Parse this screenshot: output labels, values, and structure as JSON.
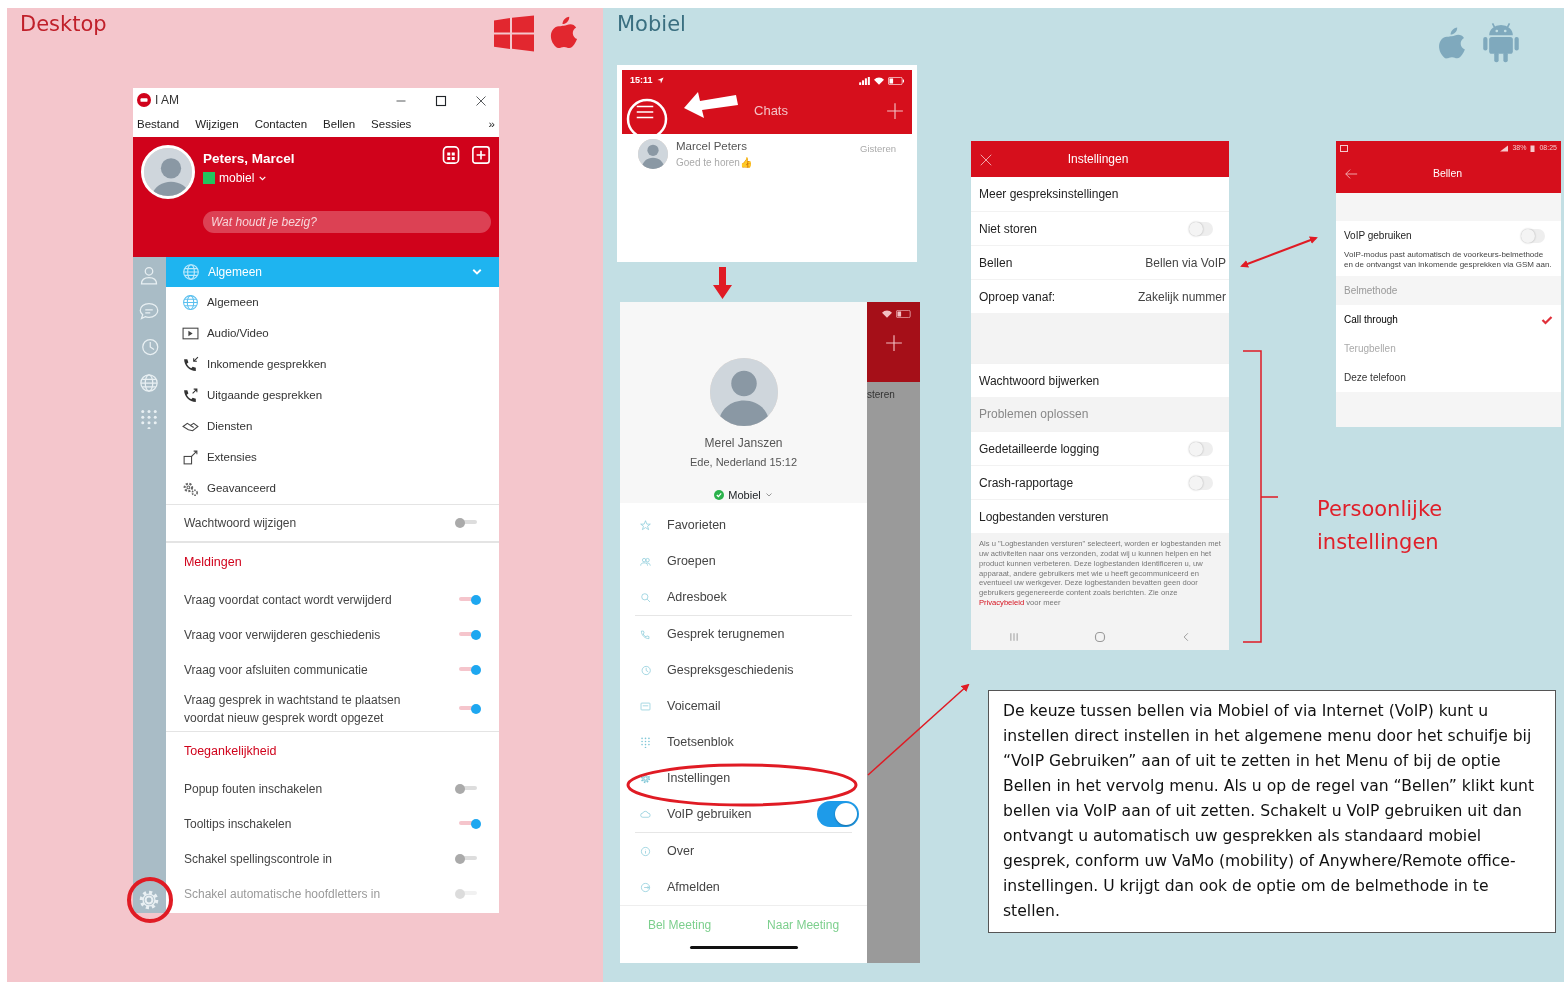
{
  "desktop_label": "Desktop",
  "mobile_label": "Mobiel",
  "desktop_app": {
    "title": "I AM",
    "menu": [
      "Bestand",
      "Wijzigen",
      "Contacten",
      "Bellen",
      "Sessies"
    ],
    "menu_overflow": "»",
    "profile": {
      "name": "Peters, Marcel",
      "status": "mobiel",
      "mood_placeholder": "Wat houdt je bezig?"
    },
    "category": {
      "label": "Algemeen",
      "expanded": true,
      "items": [
        "Algemeen",
        "Audio/Video",
        "Inkomende gesprekken",
        "Uitgaande gesprekken",
        "Diensten",
        "Extensies",
        "Geavanceerd"
      ]
    },
    "settings": [
      {
        "kind": "toggle",
        "label": "Wachtwoord wijzigen",
        "on": false,
        "faded": false
      },
      {
        "kind": "heading",
        "label": "Meldingen"
      },
      {
        "kind": "toggle",
        "label": "Vraag voordat contact wordt verwijderd",
        "on": true,
        "faded": false
      },
      {
        "kind": "toggle",
        "label": "Vraag voor verwijderen geschiedenis",
        "on": true,
        "faded": false
      },
      {
        "kind": "toggle",
        "label": "Vraag voor afsluiten communicatie",
        "on": true,
        "faded": false
      },
      {
        "kind": "toggle",
        "label": "Vraag gesprek in wachtstand te plaatsen voordat nieuw gesprek wordt opgezet",
        "on": true,
        "faded": false
      },
      {
        "kind": "heading",
        "label": "Toegankelijkheid"
      },
      {
        "kind": "toggle",
        "label": "Popup fouten inschakelen",
        "on": false,
        "faded": false
      },
      {
        "kind": "toggle",
        "label": "Tooltips inschakelen",
        "on": true,
        "faded": false
      },
      {
        "kind": "toggle",
        "label": "Schakel spellingscontrole in",
        "on": false,
        "faded": false
      },
      {
        "kind": "toggle",
        "label": "Schakel automatische hoofdletters in",
        "on": false,
        "faded": true
      }
    ]
  },
  "ios_chats": {
    "time": "15:11",
    "title": "Chats",
    "chats": [
      {
        "name": "Marcel Peters",
        "message": "Goed te horen👍",
        "time": "Gisteren"
      }
    ]
  },
  "ios_drawer": {
    "name": "Merel Janszen",
    "location": "Ede, Nederland 15:12",
    "status": "Mobiel",
    "groups": [
      [
        {
          "kind": "link",
          "label": "Favorieten"
        },
        {
          "kind": "link",
          "label": "Groepen"
        },
        {
          "kind": "link",
          "label": "Adresboek"
        }
      ],
      [
        {
          "kind": "link",
          "label": "Gesprek terugnemen"
        },
        {
          "kind": "link",
          "label": "Gespreksgeschiedenis"
        },
        {
          "kind": "link",
          "label": "Voicemail"
        },
        {
          "kind": "link",
          "label": "Toetsenblok"
        },
        {
          "kind": "link",
          "label": "Instellingen"
        },
        {
          "kind": "toggle",
          "label": "VoIP gebruiken",
          "on": true
        }
      ],
      [
        {
          "kind": "link",
          "label": "Over"
        },
        {
          "kind": "link",
          "label": "Afmelden"
        }
      ]
    ],
    "footer": [
      "Bel Meeting",
      "Naar Meeting"
    ],
    "behind_text": "steren"
  },
  "android_settings": {
    "title": "Instellingen",
    "rows": [
      {
        "kind": "link",
        "label": "Meer gespreksinstellingen"
      },
      {
        "kind": "toggle",
        "label": "Niet storen",
        "on": false
      },
      {
        "kind": "value",
        "label": "Bellen",
        "value": "Bellen via VoIP"
      },
      {
        "kind": "value",
        "label": "Oproep vanaf:",
        "value": "Zakelijk nummer"
      },
      {
        "kind": "gap"
      },
      {
        "kind": "link",
        "label": "Wachtwoord bijwerken"
      },
      {
        "kind": "heading",
        "label": "Problemen oplossen"
      },
      {
        "kind": "toggle",
        "label": "Gedetailleerde logging",
        "on": false
      },
      {
        "kind": "toggle",
        "label": "Crash-rapportage",
        "on": false
      },
      {
        "kind": "link",
        "label": "Logbestanden versturen"
      }
    ],
    "notice": {
      "text": "Als u \"Logbestanden versturen\" selecteert, worden er logbestanden met uw activiteiten naar ons verzonden, zodat wij u kunnen helpen en het product kunnen verbeteren. Deze logbestanden identificeren u, uw apparaat, andere gebruikers met wie u heeft gecommuniceerd en eventueel uw werkgever. Deze logbestanden bevatten geen door gebruikers gegenereerde content zoals berichten. Zie onze ",
      "link": "Privacybeleid",
      "after": " voor meer"
    }
  },
  "android_bellen": {
    "battery": "38%",
    "time": "08:25",
    "title": "Bellen",
    "voip": {
      "label": "VoIP gebruiken",
      "on": false
    },
    "description": "VoIP-modus past automatisch de voorkeurs-belmethode en de ontvangst van inkomende gesprekken via GSM aan.",
    "method_heading": "Belmethode",
    "methods": [
      {
        "label": "Call through",
        "selected": true,
        "disabled": false
      },
      {
        "label": "Terugbellen",
        "selected": false,
        "disabled": true
      },
      {
        "label": "Deze telefoon",
        "selected": false,
        "disabled": false
      }
    ]
  },
  "annotation": "Persoonlijke instellingen",
  "explanation": "De keuze tussen bellen via Mobiel of via Internet (VoIP) kunt u instellen direct instellen in het algemene menu door het schuifje bij “VoIP Gebruiken” aan of uit te zetten in het Menu of bij de optie Bellen in het vervolg menu. Als u op de regel van “Bellen” klikt kunt bellen via VoIP aan of uit zetten. Schakelt u VoIP gebruiken uit dan ontvangt u automatisch uw gesprekken als standaard mobiel gesprek, conform uw VaMo (mobility) of Anywhere/Remote office-instellingen. U krijgt dan ook de optie om de belmethode in te stellen."
}
